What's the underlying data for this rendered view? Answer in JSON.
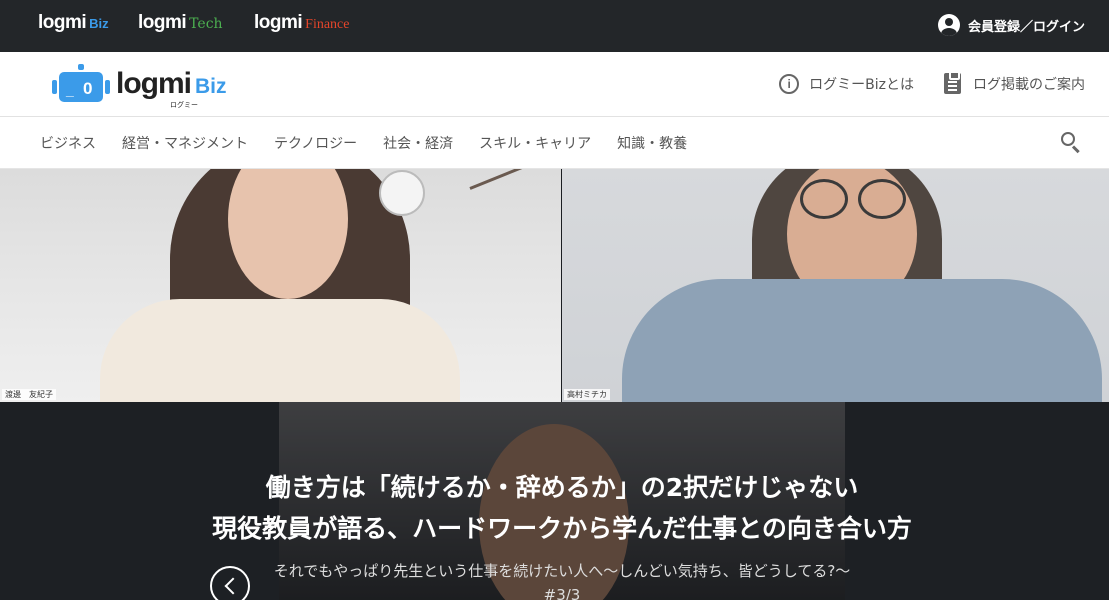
{
  "topbar": {
    "sites": [
      {
        "logo": "logmi",
        "sub": "Biz",
        "sub_color": "#3b9be9"
      },
      {
        "logo": "logmi",
        "sub": "Tech",
        "sub_color": "#4caf50"
      },
      {
        "logo": "logmi",
        "sub": "Finance",
        "sub_color": "#e3452a"
      }
    ],
    "login_label": "会員登録／ログイン",
    "login_icon": "account-circle-icon"
  },
  "header": {
    "logo": {
      "name": "logmi",
      "biz": "Biz",
      "kana": "ログミー",
      "icon": "robot-logo-icon",
      "color": "#3b9be9"
    },
    "links": [
      {
        "label": "ログミーBizとは",
        "icon": "info-icon"
      },
      {
        "label": "ログ掲載のご案内",
        "icon": "clipboard-icon"
      }
    ]
  },
  "nav": {
    "categories": [
      "ビジネス",
      "経営・マネジメント",
      "テクノロジー",
      "社会・経済",
      "スキル・キャリア",
      "知識・教養"
    ],
    "search_icon": "search-icon"
  },
  "hero": {
    "name_left": "渡邊　友紀子",
    "name_right": "高村ミチカ",
    "title_line1": "働き方は「続けるか・辞めるか」の2択だけじゃない",
    "title_line2": "現役教員が語る、ハードワークから学んだ仕事との向き合い方",
    "subtitle": "それでもやっぱり先生という仕事を続けたい人へ〜しんどい気持ち、皆どうしてる?〜",
    "count": "#3/3",
    "prev_icon": "chevron-left-icon"
  }
}
